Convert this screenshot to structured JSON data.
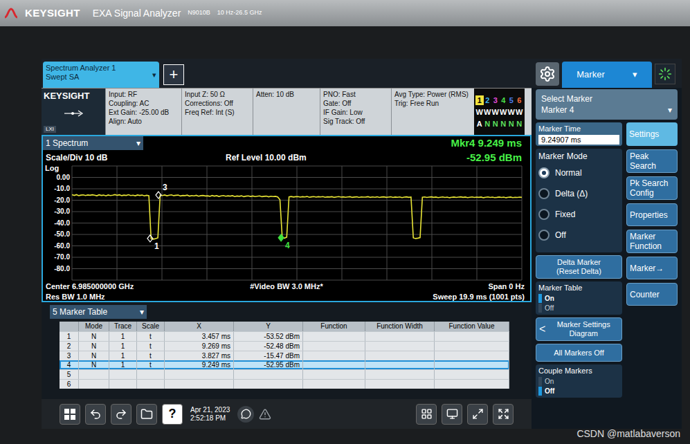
{
  "device": {
    "brand": "KEYSIGHT",
    "model": "EXA Signal Analyzer",
    "model_number": "N9010B",
    "range": "10 Hz-26.5 GHz"
  },
  "dropdown_arrow": "▾",
  "tabs": [
    {
      "label": "Spectrum Analyzer 1",
      "sublabel": "Swept SA",
      "selected": true
    }
  ],
  "add_tab": "+",
  "menu_tab": {
    "label": "Marker",
    "selected": true
  },
  "settings_bar": {
    "logo": "KEYSIGHT",
    "badge": "LXI",
    "groups": [
      [
        "Input: RF",
        "Coupling: AC",
        "Ext Gain: -25.00 dB",
        "Align: Auto"
      ],
      [
        "Input Z: 50 Ω",
        "Corrections: Off",
        "Freq Ref: Int (S)"
      ],
      [
        "Atten: 10 dB"
      ],
      [
        "PNO: Fast",
        "Gate: Off",
        "IF Gain: Low",
        "Sig Track: Off"
      ],
      [
        "Avg Type: Power (RMS)",
        "Trig: Free Run"
      ]
    ]
  },
  "traces": [
    {
      "number": "1",
      "type": "W",
      "detector": "A",
      "color": "#f2e33c",
      "selected": true
    },
    {
      "number": "2",
      "type": "W",
      "detector": "N",
      "color": "#3fb3f0",
      "selected": false
    },
    {
      "number": "3",
      "type": "W",
      "detector": "N",
      "color": "#e04cd8",
      "selected": false
    },
    {
      "number": "4",
      "type": "W",
      "detector": "N",
      "color": "#4ae04a",
      "selected": false
    },
    {
      "number": "5",
      "type": "W",
      "detector": "N",
      "color": "#4a7cf0",
      "selected": false
    },
    {
      "number": "6",
      "type": "W",
      "detector": "N",
      "color": "#f06a3c",
      "selected": false
    }
  ],
  "spectrum": {
    "title": "1 Spectrum",
    "marker_readout": {
      "label": "Mkr4 9.249 ms",
      "value": "-52.95 dBm"
    },
    "scale": "Scale/Div 10 dB",
    "scale_type": "Log",
    "ref_level": "Ref Level 10.00 dBm",
    "y_ticks": [
      "0.00",
      "-10.0",
      "-20.0",
      "-30.0",
      "-40.0",
      "-50.0",
      "-60.0",
      "-70.0",
      "-80.0"
    ],
    "y_top_dbm": 10,
    "y_bottom_dbm": -90,
    "x_start_ms": 0,
    "x_end_ms": 19.9,
    "footer": {
      "center": "Center 6.985000000 GHz",
      "res_bw": "Res BW 1.0 MHz",
      "video_bw": "#Video BW 3.0 MHz*",
      "span": "Span 0 Hz",
      "sweep": "Sweep 19.9 ms (1001 pts)"
    },
    "series": [
      {
        "name": "Trace 1",
        "color": "#e8e436",
        "values": [
          -15.2,
          -15.8,
          -15.1,
          -16.0,
          -15.5,
          -15.3,
          -15.9,
          -15.4,
          -15.7,
          -15.2,
          -15.6,
          -16.1,
          -15.3,
          -15.8,
          -15.5,
          -16.2,
          -15.4,
          -15.9,
          -15.6,
          -15.1,
          -15.7,
          -15.3,
          -16.0,
          -15.5,
          -15.8,
          -15.2,
          -15.9,
          -15.6,
          -16.1,
          -15.4,
          -15.8,
          -15.5,
          -16.2,
          -15.7,
          -16.0,
          -53.5,
          -54.1,
          -53.6,
          -53.0,
          -15.5,
          -15.9,
          -15.4,
          -16.1,
          -15.6,
          -15.3,
          -16.0,
          -15.7,
          -15.5,
          -16.3,
          -15.8,
          -16.0,
          -15.6,
          -16.4,
          -15.9,
          -16.2,
          -15.7,
          -16.5,
          -16.0,
          -15.8,
          -16.3,
          -16.1,
          -16.6,
          -15.9,
          -16.4,
          -16.0,
          -16.7,
          -16.2,
          -15.9,
          -16.5,
          -16.1,
          -16.4,
          -16.0,
          -16.8,
          -16.3,
          -16.6,
          -16.1,
          -16.9,
          -16.4,
          -16.2,
          -16.7,
          -16.3,
          -16.8,
          -16.5,
          -16.2,
          -16.9,
          -16.6,
          -16.4,
          -17.0,
          -16.5,
          -16.8,
          -16.6,
          -17.1,
          -19.5,
          -52.5,
          -53.2,
          -52.4,
          -17.0,
          -16.7,
          -17.2,
          -16.9,
          -16.8,
          -17.3,
          -16.9,
          -17.1,
          -16.7,
          -17.4,
          -17.0,
          -16.8,
          -17.3,
          -16.9,
          -17.1,
          -16.8,
          -17.4,
          -17.0,
          -17.2,
          -16.9,
          -17.5,
          -17.1,
          -16.8,
          -17.3,
          -17.0,
          -17.4,
          -17.1,
          -16.9,
          -17.5,
          -17.2,
          -17.0,
          -17.6,
          -17.1,
          -17.3,
          -17.2,
          -16.9,
          -17.5,
          -17.1,
          -17.4,
          -17.0,
          -17.6,
          -17.2,
          -17.0,
          -17.5,
          -17.3,
          -17.0,
          -17.6,
          -17.2,
          -17.4,
          -17.1,
          -17.7,
          -17.3,
          -17.0,
          -17.5,
          -17.2,
          -53.0,
          -53.6,
          -53.3,
          -52.8,
          -17.4,
          -17.1,
          -17.6,
          -17.3,
          -17.0,
          -17.5,
          -17.2,
          -17.7,
          -17.4,
          -17.1,
          -17.6,
          -17.3,
          -17.8,
          -17.4,
          -17.2,
          -17.6,
          -17.3,
          -17.0,
          -17.5,
          -17.2,
          -17.7,
          -17.4,
          -17.1,
          -17.6,
          -17.3,
          -17.5,
          -17.2,
          -17.8,
          -17.4,
          -17.1,
          -17.6,
          -17.3,
          -17.7,
          -17.5,
          -17.2,
          -17.6,
          -17.3,
          -17.8,
          -17.4,
          -17.2,
          -17.7,
          -17.4,
          -17.6,
          -17.3,
          -17.5
        ]
      }
    ],
    "markers": [
      {
        "label": "1",
        "x_ms": 3.457,
        "y_dbm": -53.52,
        "selected": false
      },
      {
        "label": "3",
        "x_ms": 3.827,
        "y_dbm": -15.47,
        "selected": false
      },
      {
        "label": "4",
        "x_ms": 9.249,
        "y_dbm": -52.95,
        "selected": true
      }
    ]
  },
  "marker_table": {
    "title": "5 Marker Table",
    "columns": [
      {
        "key": "index",
        "label": ""
      },
      {
        "key": "mode",
        "label": "Mode"
      },
      {
        "key": "trace",
        "label": "Trace"
      },
      {
        "key": "scale",
        "label": "Scale"
      },
      {
        "key": "x",
        "label": "X"
      },
      {
        "key": "y",
        "label": "Y"
      },
      {
        "key": "function",
        "label": "Function"
      },
      {
        "key": "function_width",
        "label": "Function Width"
      },
      {
        "key": "function_value",
        "label": "Function Value"
      }
    ],
    "rows": [
      {
        "index": "1",
        "mode": "N",
        "trace": "1",
        "scale": "t",
        "x": "3.457 ms",
        "y": "-53.52 dBm",
        "function": "",
        "function_width": "",
        "function_value": "",
        "selected": false
      },
      {
        "index": "2",
        "mode": "N",
        "trace": "1",
        "scale": "t",
        "x": "9.269 ms",
        "y": "-52.48 dBm",
        "function": "",
        "function_width": "",
        "function_value": "",
        "selected": false
      },
      {
        "index": "3",
        "mode": "N",
        "trace": "1",
        "scale": "t",
        "x": "3.827 ms",
        "y": "-15.47 dBm",
        "function": "",
        "function_width": "",
        "function_value": "",
        "selected": false
      },
      {
        "index": "4",
        "mode": "N",
        "trace": "1",
        "scale": "t",
        "x": "9.249 ms",
        "y": "-52.95 dBm",
        "function": "",
        "function_width": "",
        "function_value": "",
        "selected": true
      },
      {
        "index": "5",
        "mode": "",
        "trace": "",
        "scale": "",
        "x": "",
        "y": "",
        "function": "",
        "function_width": "",
        "function_value": "",
        "selected": false
      },
      {
        "index": "6",
        "mode": "",
        "trace": "",
        "scale": "",
        "x": "",
        "y": "",
        "function": "",
        "function_width": "",
        "function_value": "",
        "selected": false
      }
    ]
  },
  "panel": {
    "select_marker": {
      "label": "Select Marker",
      "value": "Marker 4"
    },
    "marker_time": {
      "label": "Marker Time",
      "value": "9.24907 ms"
    },
    "marker_mode": {
      "label": "Marker Mode",
      "options": [
        {
          "label": "Normal",
          "selected": true
        },
        {
          "label": "Delta (Δ)",
          "selected": false
        },
        {
          "label": "Fixed",
          "selected": false
        },
        {
          "label": "Off",
          "selected": false
        }
      ]
    },
    "side_buttons": [
      {
        "label": "Settings",
        "selected": true
      },
      {
        "label": "Peak Search",
        "selected": false
      },
      {
        "label": "Pk Search Config",
        "selected": false
      },
      {
        "label": "Properties",
        "selected": false
      },
      {
        "label": "Marker Function",
        "selected": false
      },
      {
        "label": "Marker→",
        "selected": false
      },
      {
        "label": "Counter",
        "selected": false
      }
    ],
    "delta_button": {
      "label": "Delta Marker",
      "sublabel": "(Reset Delta)"
    },
    "marker_table_toggle": {
      "label": "Marker Table",
      "options": [
        {
          "label": "On",
          "selected": true
        },
        {
          "label": "Off",
          "selected": false
        }
      ]
    },
    "settings_diagram": {
      "icon": "<",
      "label": "Marker Settings Diagram"
    },
    "all_off": "All Markers Off",
    "couple_toggle": {
      "label": "Couple Markers",
      "options": [
        {
          "label": "On",
          "selected": false
        },
        {
          "label": "Off",
          "selected": true
        }
      ]
    }
  },
  "taskbar": {
    "help": "?",
    "date": "Apr 21, 2023",
    "time": "2:52:18 PM"
  },
  "watermark": "CSDN @matlabaverson"
}
